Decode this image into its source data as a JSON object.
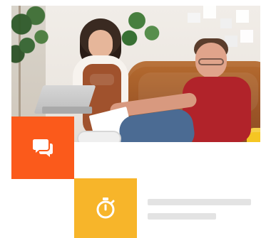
{
  "colors": {
    "orange": "#fb5a1b",
    "yellow": "#f7b52a",
    "placeholder_gray": "#e3e3e3",
    "white": "#ffffff"
  },
  "icons": {
    "chat": "chat-bubbles-icon",
    "timer": "stopwatch-icon"
  }
}
